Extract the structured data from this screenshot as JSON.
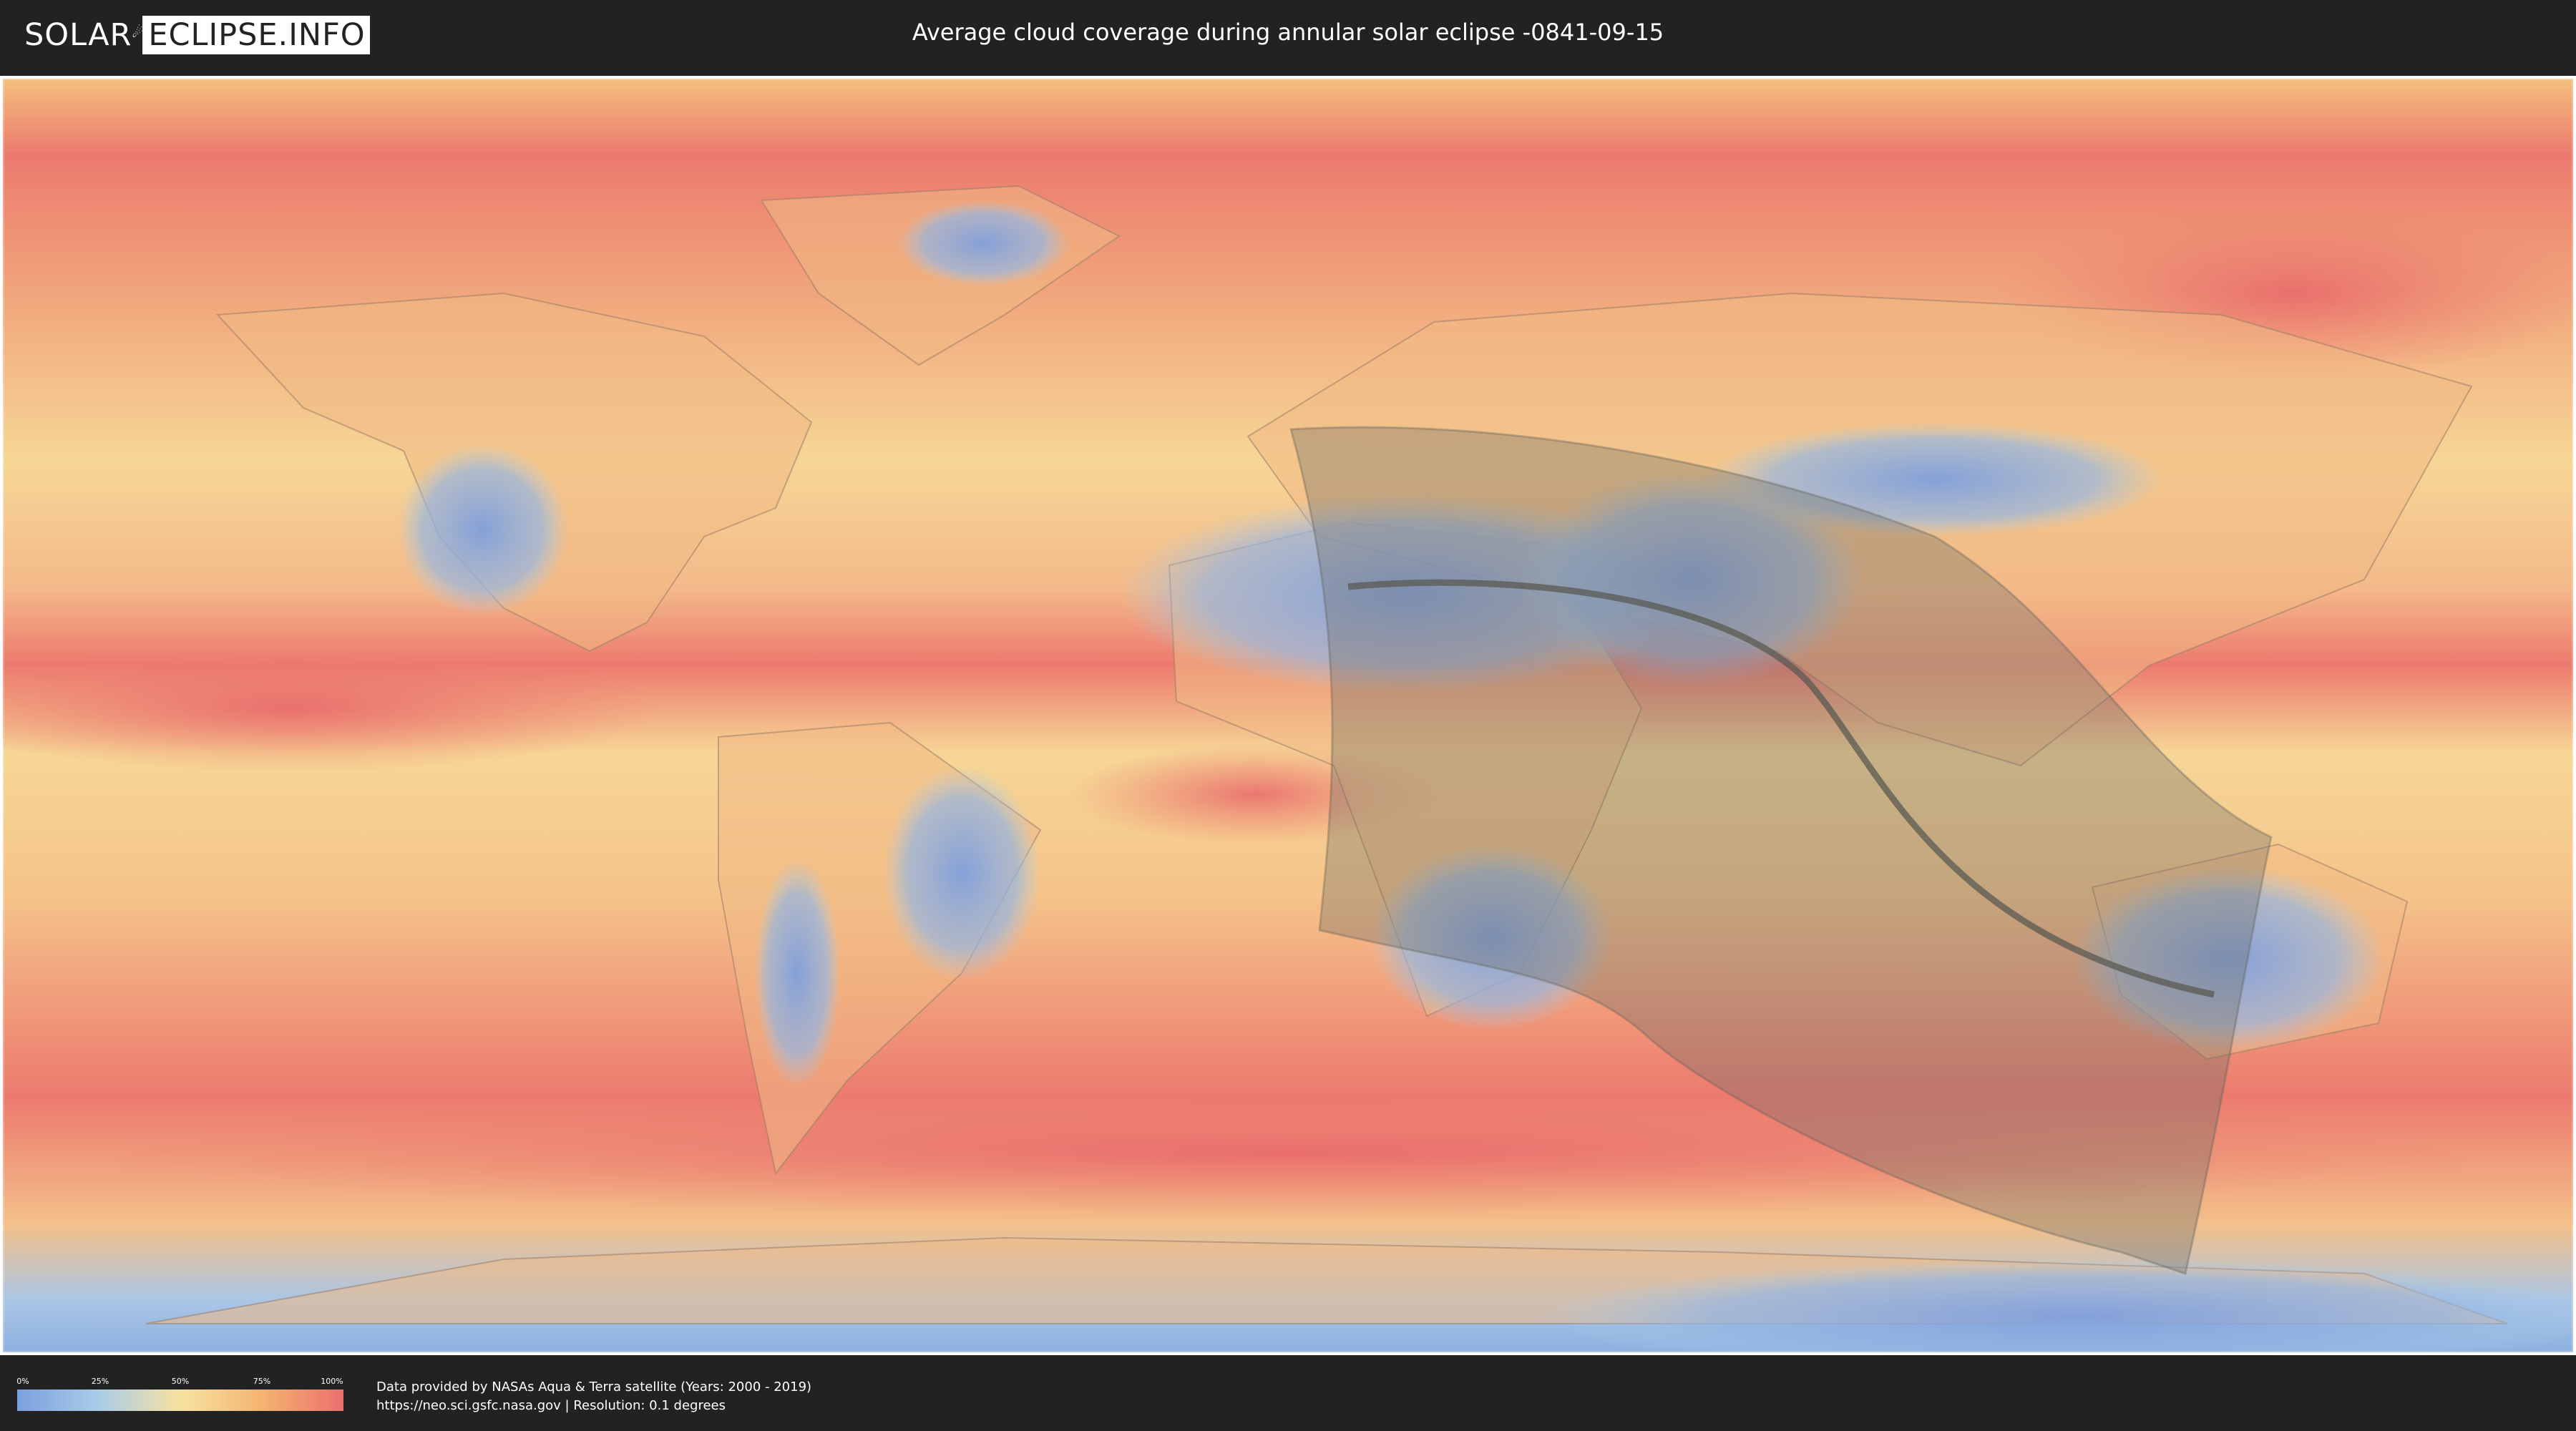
{
  "header": {
    "logo_left": "SOLAR",
    "logo_right": "ECLIPSE.INFO",
    "title": "Average cloud coverage during annular solar eclipse -0841-09-15"
  },
  "legend": {
    "ticks": [
      "0%",
      "25%",
      "50%",
      "75%",
      "100%"
    ],
    "colors": [
      "#7c9fe0",
      "#a9cde8",
      "#f6e2a0",
      "#f4b36f",
      "#ec6f6f"
    ]
  },
  "credits": {
    "line1": "Data provided by NASAs Aqua & Terra satellite (Years: 2000 - 2019)",
    "line2": "https://neo.sci.gsfc.nasa.gov | Resolution: 0.1 degrees"
  },
  "map": {
    "cloudy_color": "#ec7a6e",
    "mid_color": "#f6d696",
    "clear_color": "#86a8de",
    "eclipse_shadow_color": "#6e6e66",
    "central_line_color": "#5a5a52"
  }
}
